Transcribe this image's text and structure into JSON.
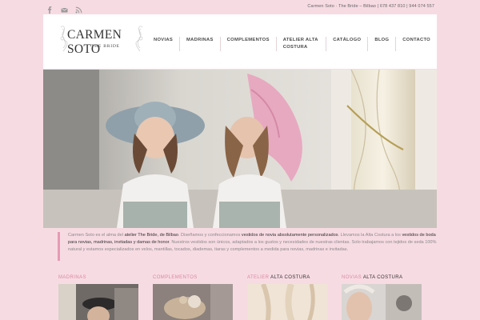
{
  "topbar": {
    "social": [
      "facebook-icon",
      "mail-icon",
      "rss-icon"
    ],
    "contact_text": "Carmen Soto · The Bride – Bilbao | 678 437 810 | 944 074 557"
  },
  "header": {
    "logo_name": "CARMEN SOTO",
    "logo_sub": "THE BRIDE",
    "nav": [
      "NOVIAS",
      "MADRINAS",
      "COMPLEMENTOS",
      "ATELIER ALTA COSTURA",
      "CATÁLOGO",
      "BLOG",
      "CONTACTO"
    ]
  },
  "intro": {
    "p1": "Carmen Soto es el alma del ",
    "s1": "atelier The Bride, de Bilbao",
    "p2": ". Diseñamos y confeccionamos ",
    "s2": "vestidos de novia absolutamente personalizados",
    "p3": ". Llevamos la Alta Costura a los ",
    "s3": "vestidos de boda para novias, madrinas, invitadas y damas de honor",
    "p4": ". Nuestros vestidos son únicos, adaptados a los gustos y necesidades de nuestras clientas. Solo trabajamos con tejidos de seda 100% natural y estamos especializados en velos, mantillas, tocados, diademas, tiaras y complementos a medida para novias, madrinas e invitadas."
  },
  "sections": [
    {
      "pink": "MADRINAS",
      "dark": ""
    },
    {
      "pink": "COMPLEMENTOS",
      "dark": ""
    },
    {
      "pink": "ATELIER",
      "dark": " ALTA COSTURA"
    },
    {
      "pink": "NOVIAS",
      "dark": " ALTA COSTURA"
    }
  ],
  "colors": {
    "background": "#f7dbe3",
    "accent": "#e69ab3",
    "section_title": "#d98aa3"
  }
}
